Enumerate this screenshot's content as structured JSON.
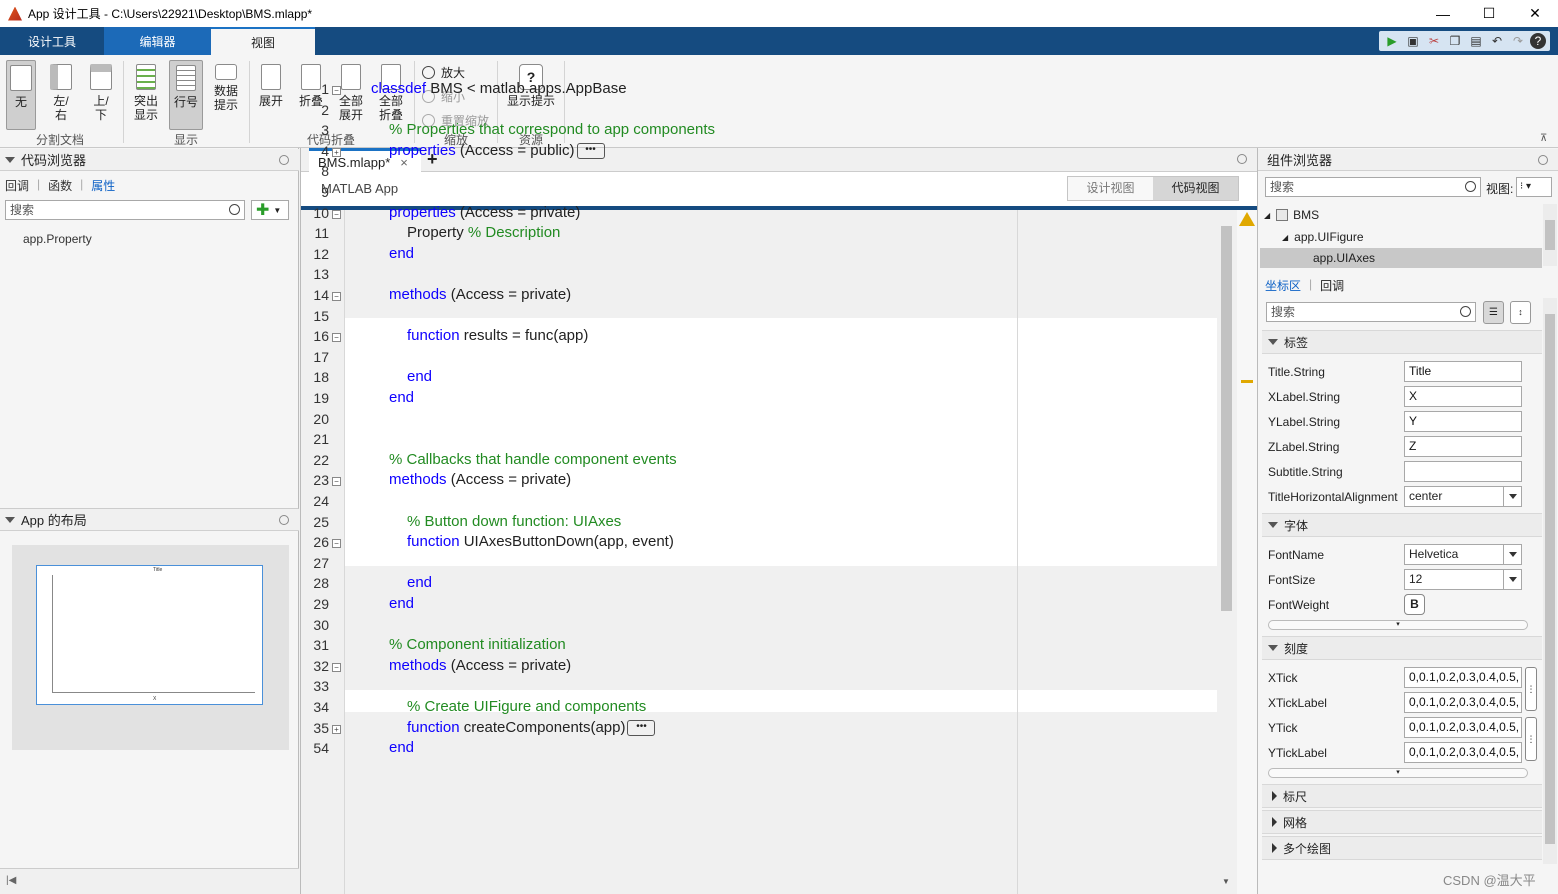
{
  "window": {
    "title": "App 设计工具 - C:\\Users\\22921\\Desktop\\BMS.mlapp*",
    "minimize": "—",
    "maximize": "☐",
    "close": "✕"
  },
  "tabs": [
    {
      "label": "设计工具"
    },
    {
      "label": "编辑器"
    },
    {
      "label": "视图"
    }
  ],
  "ribbon": {
    "layout": {
      "none": "无",
      "left_right": "左/\n右",
      "top_bottom": "上/\n下",
      "group": "分割文档"
    },
    "display": {
      "highlight": "突出\n显示",
      "line_numbers": "行号",
      "datatips": "数据\n提示",
      "group": "显示"
    },
    "code_folding": {
      "expand": "展开",
      "collapse": "折叠",
      "expand_all": "全部\n展开",
      "collapse_all": "全部\n折叠",
      "group": "代码折叠"
    },
    "zoom": {
      "zoom_in": "放大",
      "zoom_out": "缩小",
      "reset": "重置缩放",
      "group": "缩放"
    },
    "resources": {
      "show_tips": "显示提示",
      "group": "资源"
    }
  },
  "code_browser": {
    "title": "代码浏览器",
    "tabs": [
      "回调",
      "函数",
      "属性"
    ],
    "search_placeholder": "搜索",
    "items": [
      "app.Property"
    ]
  },
  "app_layout": {
    "title": "App 的布局",
    "preview_title": "Title",
    "preview_xlabel": "X"
  },
  "editor": {
    "file_tab": "BMS.mlapp*",
    "close": "×",
    "add_tab": "+",
    "app_label": "MATLAB App",
    "view_design": "设计视图",
    "view_code": "代码视图"
  },
  "code_lines": [
    {
      "n": "1",
      "fold": "−",
      "parts": [
        [
          "kw",
          "classdef"
        ],
        [
          "t",
          " BMS < matlab.apps.AppBase"
        ]
      ],
      "indent": 0
    },
    {
      "n": "2",
      "parts": [],
      "indent": 0
    },
    {
      "n": "3",
      "parts": [
        [
          "cm",
          "% Properties that correspond to app components"
        ]
      ],
      "indent": 1
    },
    {
      "n": "4",
      "fold": "+",
      "parts": [
        [
          "kw",
          "properties"
        ],
        [
          "t",
          " (Access = public)"
        ],
        [
          "ell",
          "•••"
        ]
      ],
      "indent": 1
    },
    {
      "n": "8",
      "parts": [],
      "indent": 0
    },
    {
      "n": "9",
      "parts": [],
      "indent": 0
    },
    {
      "n": "10",
      "fold": "−",
      "parts": [
        [
          "kw",
          "properties"
        ],
        [
          "t",
          " (Access = private)"
        ]
      ],
      "indent": 1
    },
    {
      "n": "11",
      "parts": [
        [
          "t",
          "Property "
        ],
        [
          "cm",
          "% Description"
        ]
      ],
      "indent": 2
    },
    {
      "n": "12",
      "parts": [
        [
          "kw",
          "end"
        ]
      ],
      "indent": 1
    },
    {
      "n": "13",
      "parts": [],
      "indent": 0
    },
    {
      "n": "14",
      "fold": "−",
      "parts": [
        [
          "kw",
          "methods"
        ],
        [
          "t",
          " (Access = private)"
        ]
      ],
      "indent": 1
    },
    {
      "n": "15",
      "parts": [],
      "indent": 0
    },
    {
      "n": "16",
      "fold": "−",
      "parts": [
        [
          "kw",
          "function"
        ],
        [
          "t",
          " results = func(app)"
        ]
      ],
      "indent": 2
    },
    {
      "n": "17",
      "parts": [],
      "indent": 0
    },
    {
      "n": "18",
      "parts": [
        [
          "kw",
          "end"
        ]
      ],
      "indent": 2
    },
    {
      "n": "19",
      "parts": [
        [
          "kw",
          "end"
        ]
      ],
      "indent": 1
    },
    {
      "n": "20",
      "parts": [],
      "indent": 0
    },
    {
      "n": "21",
      "parts": [],
      "indent": 0
    },
    {
      "n": "22",
      "parts": [
        [
          "cm",
          "% Callbacks that handle component events"
        ]
      ],
      "indent": 1
    },
    {
      "n": "23",
      "fold": "−",
      "parts": [
        [
          "kw",
          "methods"
        ],
        [
          "t",
          " (Access = private)"
        ]
      ],
      "indent": 1
    },
    {
      "n": "24",
      "parts": [],
      "indent": 0
    },
    {
      "n": "25",
      "parts": [
        [
          "cm",
          "% Button down function: UIAxes"
        ]
      ],
      "indent": 2
    },
    {
      "n": "26",
      "fold": "−",
      "parts": [
        [
          "kw",
          "function"
        ],
        [
          "t",
          " UIAxesButtonDown(app, event)"
        ]
      ],
      "indent": 2
    },
    {
      "n": "27",
      "parts": [],
      "indent": 0
    },
    {
      "n": "28",
      "parts": [
        [
          "kw",
          "end"
        ]
      ],
      "indent": 2
    },
    {
      "n": "29",
      "parts": [
        [
          "kw",
          "end"
        ]
      ],
      "indent": 1
    },
    {
      "n": "30",
      "parts": [],
      "indent": 0
    },
    {
      "n": "31",
      "parts": [
        [
          "cm",
          "% Component initialization"
        ]
      ],
      "indent": 1
    },
    {
      "n": "32",
      "fold": "−",
      "parts": [
        [
          "kw",
          "methods"
        ],
        [
          "t",
          " (Access = private)"
        ]
      ],
      "indent": 1
    },
    {
      "n": "33",
      "parts": [],
      "indent": 0
    },
    {
      "n": "34",
      "parts": [
        [
          "cm",
          "% Create UIFigure and components"
        ]
      ],
      "indent": 2
    },
    {
      "n": "35",
      "fold": "+",
      "parts": [
        [
          "kw",
          "function"
        ],
        [
          "t",
          " createComponents(app)"
        ],
        [
          "ell",
          "•••"
        ]
      ],
      "indent": 2
    },
    {
      "n": "54",
      "parts": [
        [
          "kw",
          "end"
        ]
      ],
      "indent": 1
    }
  ],
  "component_browser": {
    "title": "组件浏览器",
    "search_placeholder": "搜索",
    "view_label": "视图:",
    "tree": [
      {
        "label": "BMS"
      },
      {
        "label": "app.UIFigure"
      },
      {
        "label": "app.UIAxes"
      }
    ],
    "inspector_tabs": [
      "坐标区",
      "回调"
    ],
    "prop_search_placeholder": "搜索",
    "sections": {
      "labels": "标签",
      "font": "字体",
      "ticks": "刻度",
      "rulers": "标尺",
      "grid": "网格",
      "multi": "多个绘图"
    },
    "label_props": [
      {
        "name": "Title.String",
        "value": "Title"
      },
      {
        "name": "XLabel.String",
        "value": "X"
      },
      {
        "name": "YLabel.String",
        "value": "Y"
      },
      {
        "name": "ZLabel.String",
        "value": "Z"
      },
      {
        "name": "Subtitle.String",
        "value": ""
      }
    ],
    "title_align": {
      "name": "TitleHorizontalAlignment",
      "value": "center"
    },
    "font_props": {
      "fontname": {
        "name": "FontName",
        "value": "Helvetica"
      },
      "fontsize": {
        "name": "FontSize",
        "value": "12"
      },
      "fontweight": {
        "name": "FontWeight",
        "value": "B"
      }
    },
    "tick_props": [
      {
        "name": "XTick",
        "value": "0,0.1,0.2,0.3,0.4,0.5,"
      },
      {
        "name": "XTickLabel",
        "value": "0,0.1,0.2,0.3,0.4,0.5,"
      },
      {
        "name": "YTick",
        "value": "0,0.1,0.2,0.3,0.4,0.5,"
      },
      {
        "name": "YTickLabel",
        "value": "0,0.1,0.2,0.3,0.4,0.5,"
      }
    ]
  },
  "watermark": "CSDN @温大平"
}
